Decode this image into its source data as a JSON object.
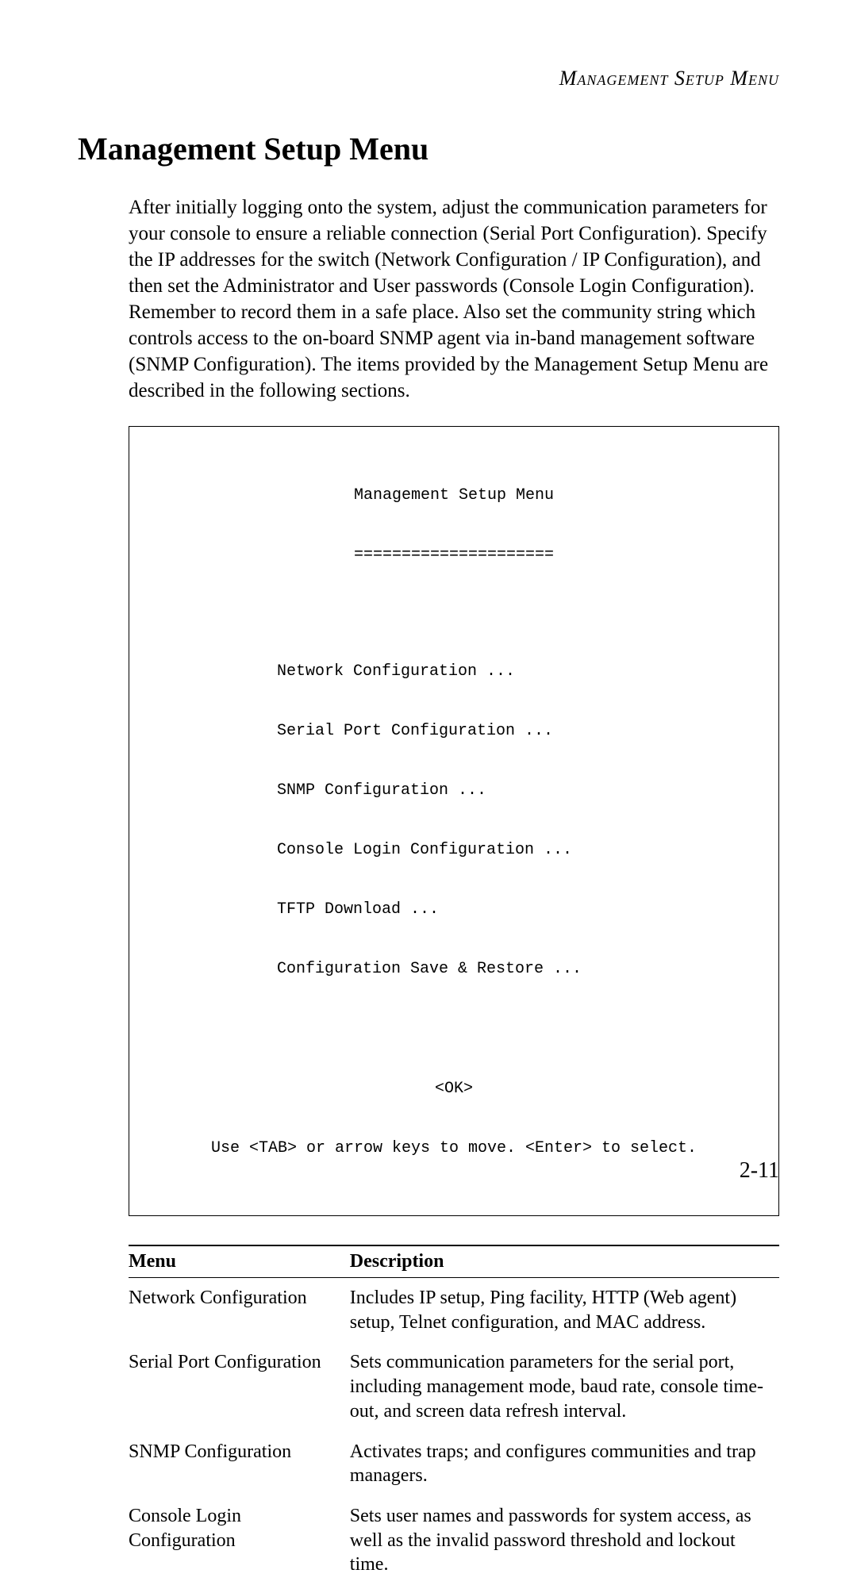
{
  "running_head": "Management Setup Menu",
  "heading": "Management Setup Menu",
  "paragraph": "After initially logging onto the system, adjust the communication parameters for your console to ensure a reliable connection (Serial Port Configuration). Specify the IP addresses for the switch (Network Configuration / IP Configuration), and then set the Administrator and User passwords (Console Login Configuration). Remember to record them in a safe place. Also set the community string which controls access to the on-board SNMP agent via in-band management software (SNMP Configuration). The items provided by the Management Setup Menu are described in the following sections.",
  "terminal": {
    "title": "Management Setup Menu",
    "divider": "=====================",
    "items": [
      "Network Configuration ...",
      "Serial Port Configuration ...",
      "SNMP Configuration ...",
      "Console Login Configuration ...",
      "TFTP Download ...",
      "Configuration Save & Restore ..."
    ],
    "ok": "<OK>",
    "hint": "Use <TAB> or arrow keys to move. <Enter> to select."
  },
  "table": {
    "headers": {
      "menu": "Menu",
      "description": "Description"
    },
    "rows": [
      {
        "menu": "Network Configuration",
        "description": "Includes IP setup, Ping facility, HTTP (Web agent) setup, Telnet configuration, and MAC address."
      },
      {
        "menu": "Serial Port Configuration",
        "description": "Sets communication parameters for the serial port, including management mode, baud rate, console time-out, and screen data refresh interval."
      },
      {
        "menu": "SNMP Configuration",
        "description": "Activates traps; and configures communities and trap managers."
      },
      {
        "menu": "Console Login Configuration",
        "description": "Sets user names and passwords for system access, as well as the invalid password threshold and lockout time."
      }
    ]
  },
  "page_number": "2-11"
}
